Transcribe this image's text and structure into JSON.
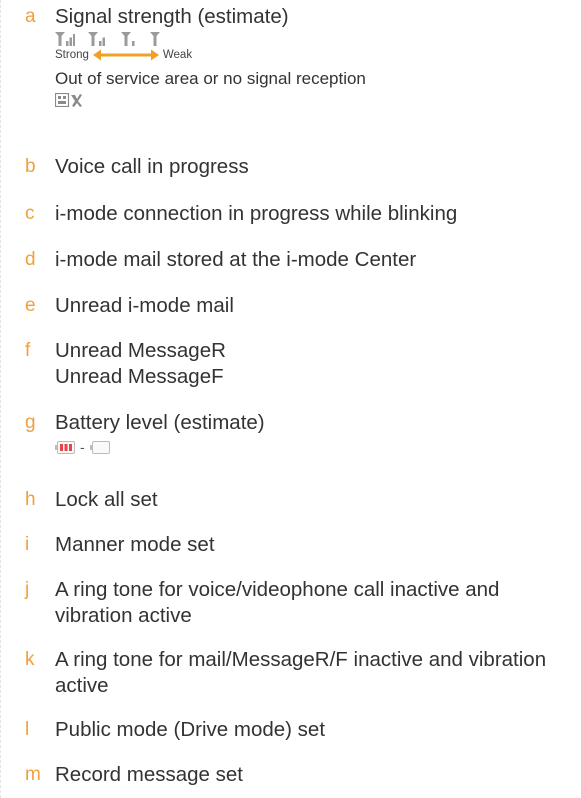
{
  "icons": {
    "signal_strong": "signal-strong-icon",
    "signal_medium": "signal-medium-icon",
    "signal_weak": "signal-weak-icon",
    "signal_none": "signal-none-icon",
    "out_of_service": "out-of-service-icon",
    "battery_full": "battery-full-icon",
    "battery_empty": "battery-empty-icon",
    "arrow": "double-arrow-icon"
  },
  "colors": {
    "letter": "#f0a03c",
    "text": "#333333",
    "arrow": "#f0a024",
    "signal_icon": "#9a9a9a",
    "battery_fill": "#e8424a"
  },
  "legend": [
    {
      "letter": "a",
      "label": "Signal strength (estimate)",
      "scale_strong": "Strong",
      "scale_weak": "Weak",
      "no_signal": "Out of service area or no signal reception"
    },
    {
      "letter": "b",
      "label": "Voice call in progress"
    },
    {
      "letter": "c",
      "label": "i-mode connection in progress while blinking"
    },
    {
      "letter": "d",
      "label": "i-mode mail stored at the i-mode Center"
    },
    {
      "letter": "e",
      "label": "Unread i-mode mail"
    },
    {
      "letter": "f",
      "label": "Unread MessageR",
      "label2": "Unread MessageF"
    },
    {
      "letter": "g",
      "label": "Battery level (estimate)",
      "range_sep": "-"
    },
    {
      "letter": "h",
      "label": "Lock all set"
    },
    {
      "letter": "i",
      "label": "Manner mode set"
    },
    {
      "letter": "j",
      "label": "A ring tone for voice/videophone call inactive and vibration active"
    },
    {
      "letter": "k",
      "label": "A ring tone for mail/MessageR/F inactive and vibration active"
    },
    {
      "letter": "l",
      "label": "Public mode (Drive mode) set"
    },
    {
      "letter": "m",
      "label": "Record message set"
    }
  ]
}
